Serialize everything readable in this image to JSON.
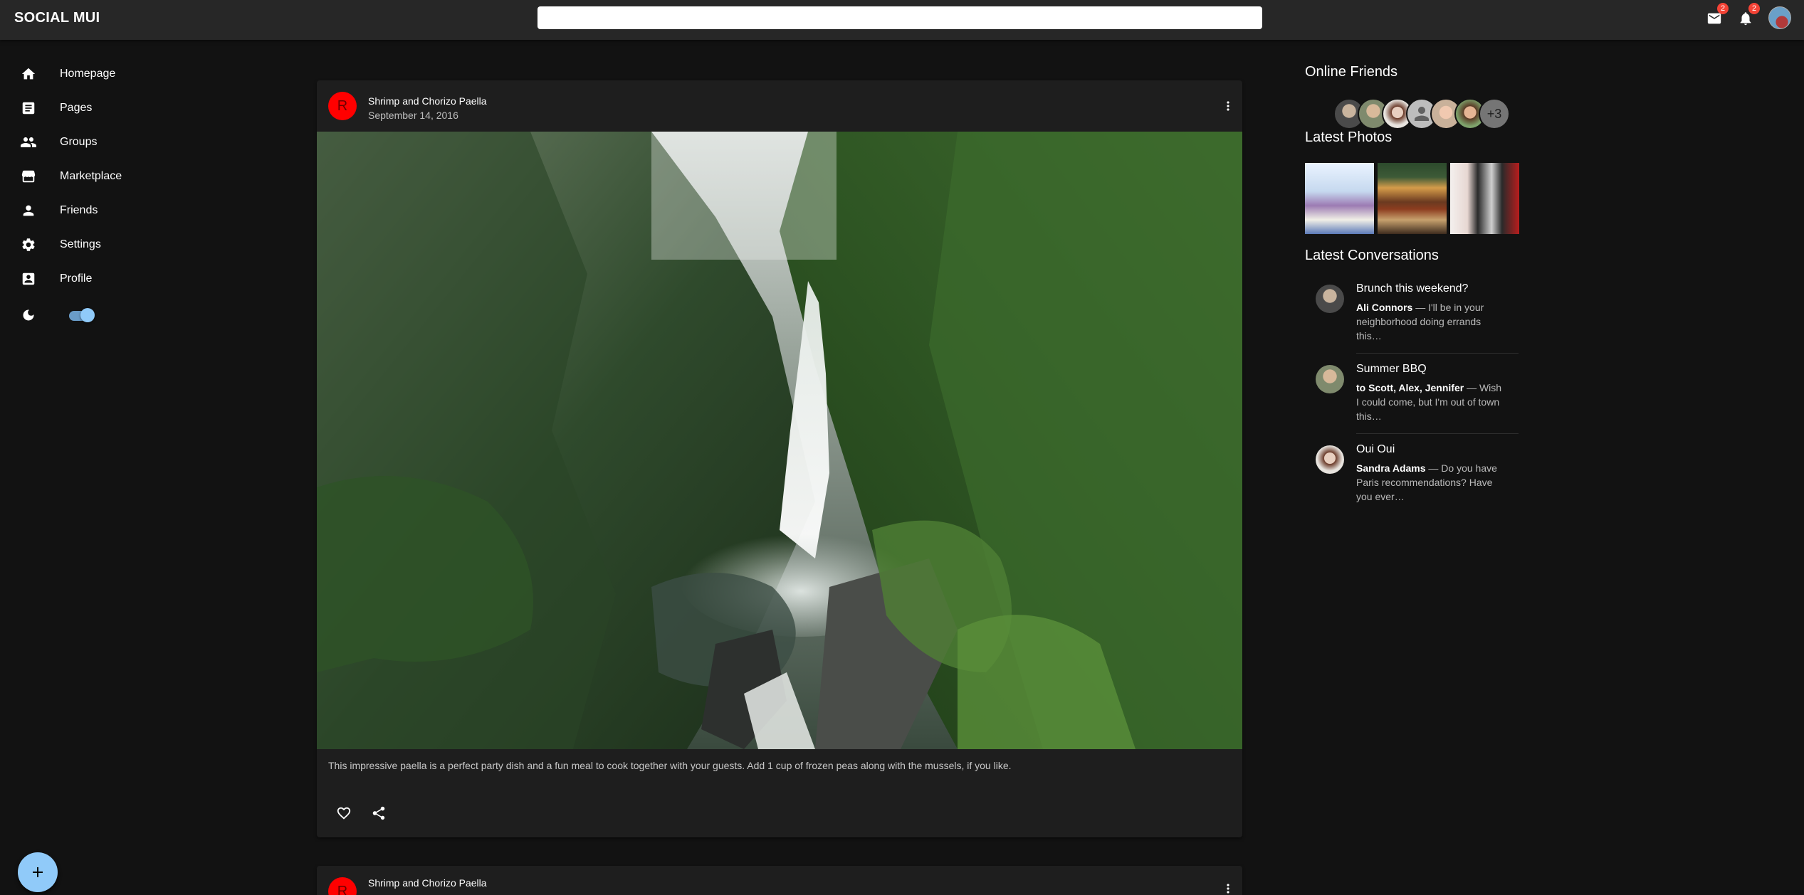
{
  "app": {
    "title": "SOCIAL MUI"
  },
  "header": {
    "search_placeholder": "",
    "mail_count": "2",
    "notifications_count": "2"
  },
  "sidebar": {
    "items": [
      {
        "label": "Homepage",
        "icon": "home-icon"
      },
      {
        "label": "Pages",
        "icon": "article-icon"
      },
      {
        "label": "Groups",
        "icon": "group-icon"
      },
      {
        "label": "Marketplace",
        "icon": "storefront-icon"
      },
      {
        "label": "Friends",
        "icon": "person-icon"
      },
      {
        "label": "Settings",
        "icon": "settings-icon"
      },
      {
        "label": "Profile",
        "icon": "account-box-icon"
      }
    ],
    "dark_mode": true
  },
  "feed": {
    "posts": [
      {
        "avatar_letter": "R",
        "title": "Shrimp and Chorizo Paella",
        "date": "September 14, 2016",
        "image": "waterfall in rainforest",
        "text": "This impressive paella is a perfect party dish and a fun meal to cook together with your guests. Add 1 cup of frozen peas along with the mussels, if you like."
      },
      {
        "avatar_letter": "R",
        "title": "Shrimp and Chorizo Paella"
      }
    ]
  },
  "rightbar": {
    "online_title": "Online Friends",
    "online_more": "+3",
    "photos_title": "Latest Photos",
    "conversations_title": "Latest Conversations",
    "conversations": [
      {
        "title": "Brunch this weekend?",
        "who": "Ali Connors",
        "snippet": " — I'll be in your neighborhood doing errands this…"
      },
      {
        "title": "Summer BBQ",
        "who": "to Scott, Alex, Jennifer",
        "snippet": " — Wish I could come, but I'm out of town this…"
      },
      {
        "title": "Oui Oui",
        "who": "Sandra Adams",
        "snippet": " — Do you have Paris recommendations? Have you ever…"
      }
    ]
  },
  "colors": {
    "background": "#121212",
    "appbar": "#272727",
    "card": "#1e1e1e",
    "accent": "#90caf9",
    "badge": "#f44336",
    "avatar": "#ff0000"
  }
}
